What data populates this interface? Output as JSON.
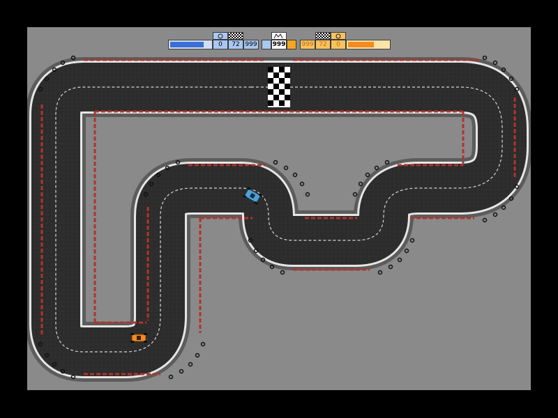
{
  "hud": {
    "player1": {
      "color": "#3b6fd6",
      "light_color": "#a9c8f2",
      "bar_level": 0.84,
      "laps": "0",
      "total_laps": "72",
      "time": "999"
    },
    "center": {
      "label": "999",
      "light_color": "#a9c8f2",
      "accent": "#f5a623"
    },
    "player2": {
      "color": "#f58a1f",
      "light_color": "#f7c260",
      "bar_level": 0.6,
      "time": "999",
      "total_laps": "72",
      "laps": "0"
    }
  },
  "track": {
    "asphalt": "#2b2b2b",
    "edge": "#e6e6e6",
    "barrier_red": "#b3332a",
    "background": "#8a8a8a"
  },
  "cars": {
    "blue": {
      "color": "#4aa3d8",
      "icon": "race-car-icon"
    },
    "orange": {
      "color": "#f58a1f",
      "icon": "race-car-icon"
    }
  }
}
